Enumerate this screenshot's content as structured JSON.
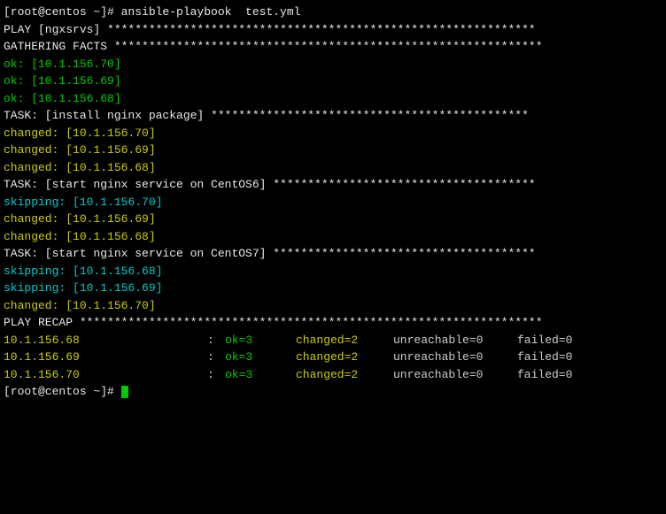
{
  "prompt1": "[root@centos ~]# ansible-playbook  test.yml",
  "blank": "",
  "play_header": "PLAY [ngxsrvs] **************************************************************",
  "gathering_header": "GATHERING FACTS **************************************************************",
  "gathering": {
    "line1": "ok: [10.1.156.70]",
    "line2": "ok: [10.1.156.69]",
    "line3": "ok: [10.1.156.68]"
  },
  "task1_header": "TASK: [install nginx package] **********************************************",
  "task1": {
    "line1": "changed: [10.1.156.70]",
    "line2": "changed: [10.1.156.69]",
    "line3": "changed: [10.1.156.68]"
  },
  "task2_header": "TASK: [start nginx service on CentOS6] **************************************",
  "task2": {
    "line1": "skipping: [10.1.156.70]",
    "line2": "changed: [10.1.156.69]",
    "line3": "changed: [10.1.156.68]"
  },
  "task3_header": "TASK: [start nginx service on CentOS7] **************************************",
  "task3": {
    "line1": "skipping: [10.1.156.68]",
    "line2": "skipping: [10.1.156.69]",
    "line3": "changed: [10.1.156.70]"
  },
  "recap_header": "PLAY RECAP *******************************************************************",
  "recap": [
    {
      "host": "10.1.156.68",
      "ok": "ok=3",
      "changed": "changed=2",
      "unreach": "unreachable=0",
      "failed": "failed=0"
    },
    {
      "host": "10.1.156.69",
      "ok": "ok=3",
      "changed": "changed=2",
      "unreach": "unreachable=0",
      "failed": "failed=0"
    },
    {
      "host": "10.1.156.70",
      "ok": "ok=3",
      "changed": "changed=2",
      "unreach": "unreachable=0",
      "failed": "failed=0"
    }
  ],
  "recap_colon": ":",
  "prompt2": "[root@centos ~]# "
}
